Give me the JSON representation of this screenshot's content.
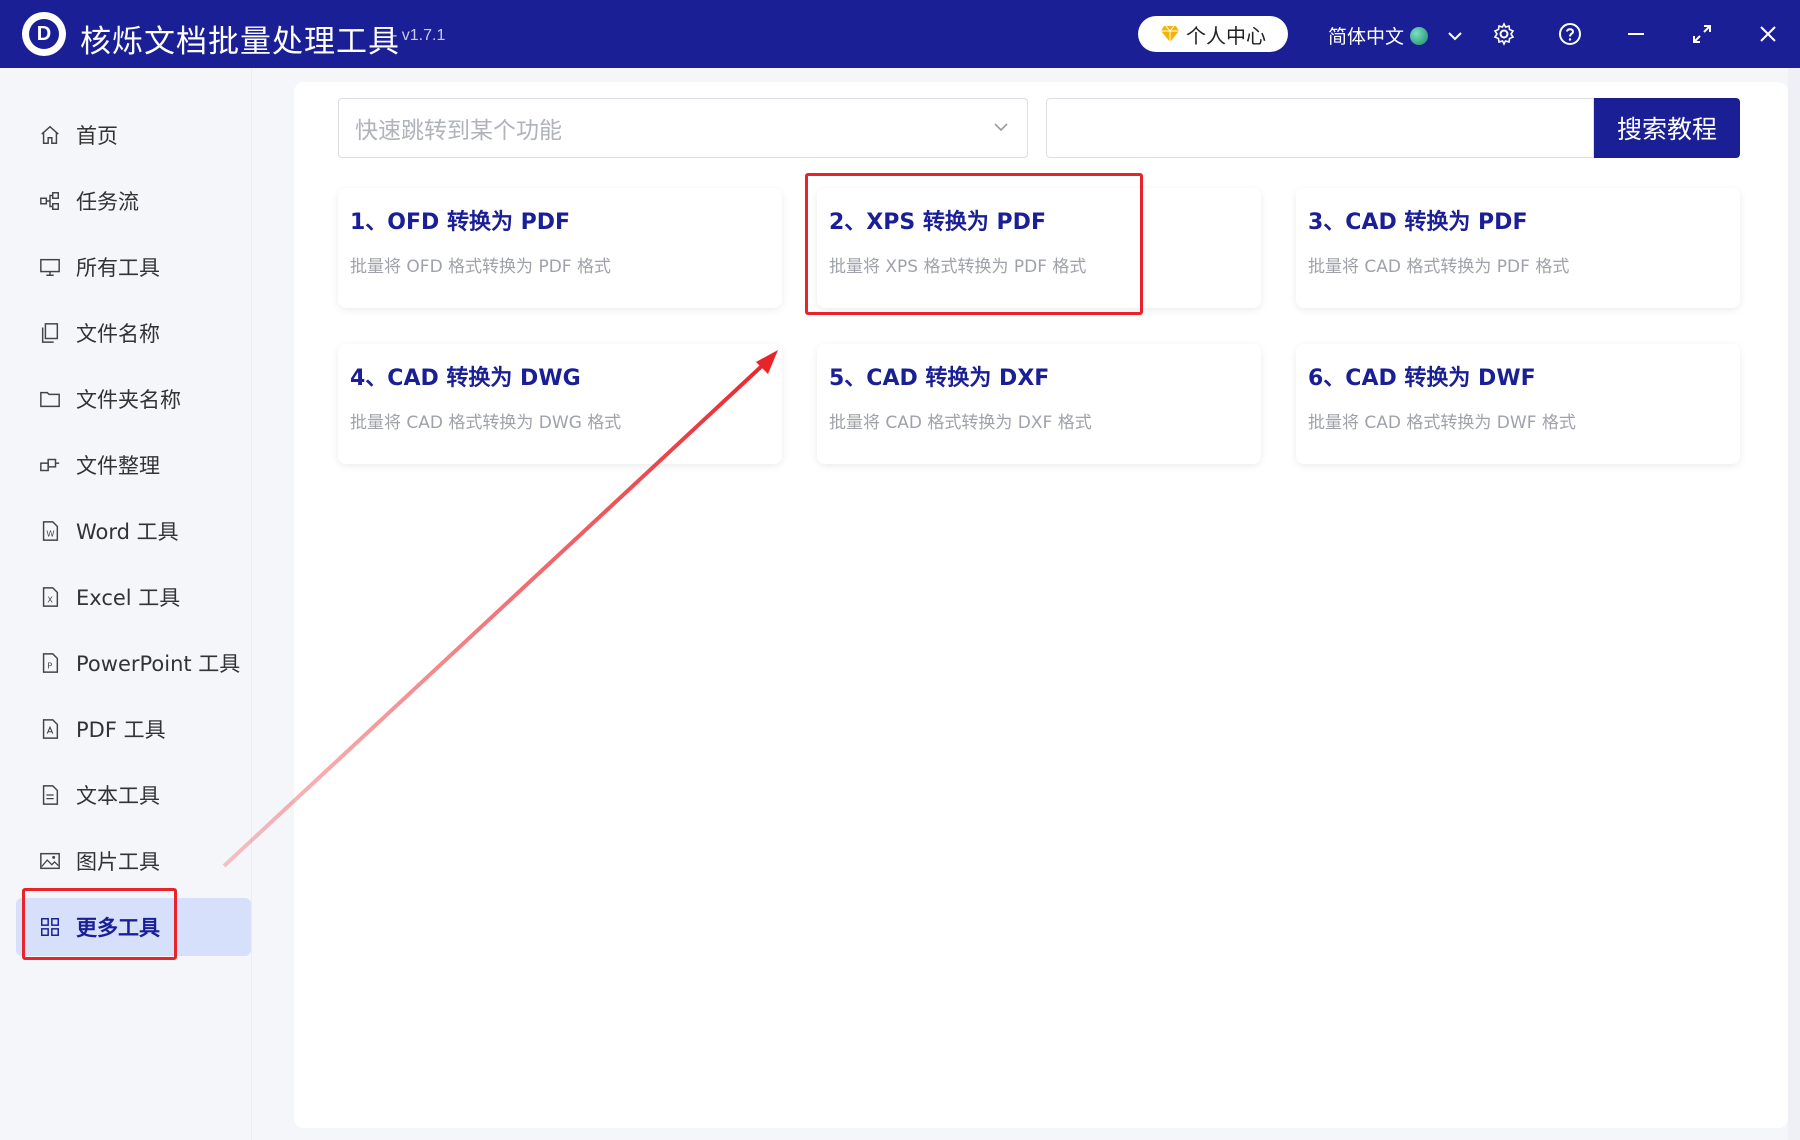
{
  "app": {
    "logo_letter": "D",
    "title": "核烁文档批量处理工具",
    "version": "- v1.7.1",
    "user_center": "个人中心",
    "language": "简体中文"
  },
  "sidebar": {
    "items": [
      {
        "label": "首页",
        "icon": "home-icon"
      },
      {
        "label": "任务流",
        "icon": "workflow-icon"
      },
      {
        "label": "所有工具",
        "icon": "monitor-icon"
      },
      {
        "label": "文件名称",
        "icon": "file-copy-icon"
      },
      {
        "label": "文件夹名称",
        "icon": "folder-icon"
      },
      {
        "label": "文件整理",
        "icon": "organize-icon"
      },
      {
        "label": "Word 工具",
        "icon": "word-icon"
      },
      {
        "label": "Excel 工具",
        "icon": "excel-icon"
      },
      {
        "label": "PowerPoint 工具",
        "icon": "powerpoint-icon"
      },
      {
        "label": "PDF 工具",
        "icon": "pdf-icon"
      },
      {
        "label": "文本工具",
        "icon": "text-icon"
      },
      {
        "label": "图片工具",
        "icon": "image-icon"
      },
      {
        "label": "更多工具",
        "icon": "grid-icon",
        "active": true
      }
    ]
  },
  "search": {
    "jump_placeholder": "快速跳转到某个功能",
    "search_value": "",
    "search_button": "搜索教程"
  },
  "cards": [
    {
      "title": "1、OFD 转换为 PDF",
      "desc": "批量将 OFD 格式转换为 PDF 格式"
    },
    {
      "title": "2、XPS 转换为 PDF",
      "desc": "批量将 XPS 格式转换为 PDF 格式"
    },
    {
      "title": "3、CAD 转换为 PDF",
      "desc": "批量将 CAD 格式转换为 PDF 格式"
    },
    {
      "title": "4、CAD 转换为 DWG",
      "desc": "批量将 CAD 格式转换为 DWG 格式"
    },
    {
      "title": "5、CAD 转换为 DXF",
      "desc": "批量将 CAD 格式转换为 DXF 格式"
    },
    {
      "title": "6、CAD 转换为 DWF",
      "desc": "批量将 CAD 格式转换为 DWF 格式"
    }
  ],
  "colors": {
    "brand": "#1a1f96",
    "active_bg": "#d6e0fb",
    "annotation": "#e8242a"
  }
}
